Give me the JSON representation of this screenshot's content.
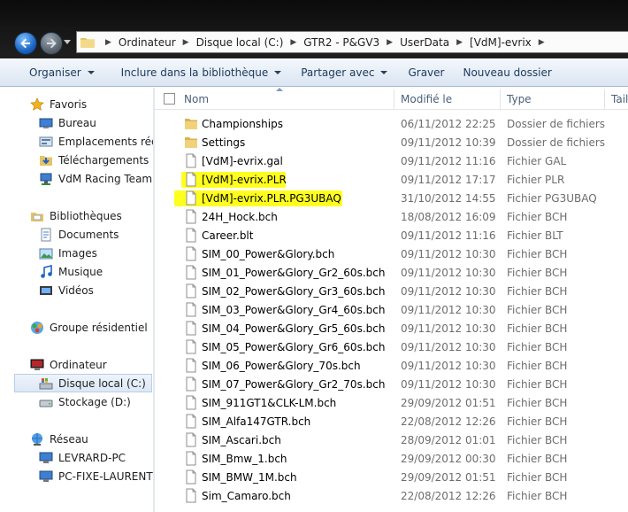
{
  "address": {
    "crumbs": [
      "Ordinateur",
      "Disque local (C:)",
      "GTR2 - P&GV3",
      "UserData",
      "[VdM]-evrix"
    ]
  },
  "toolbar": {
    "organize": "Organiser",
    "include_library": "Inclure dans la bibliothèque",
    "share_with": "Partager avec",
    "burn": "Graver",
    "new_folder": "Nouveau dossier"
  },
  "nav": {
    "favorites": "Favoris",
    "desktop": "Bureau",
    "recent": "Emplacements récents",
    "downloads": "Téléchargements",
    "vdm": "VdM Racing Team",
    "libraries": "Bibliothèques",
    "documents": "Documents",
    "images": "Images",
    "music": "Musique",
    "videos": "Vidéos",
    "homegroup": "Groupe résidentiel",
    "computer": "Ordinateur",
    "local_disk": "Disque local (C:)",
    "storage": "Stockage (D:)",
    "network": "Réseau",
    "pc1": "LEVRARD-PC",
    "pc2": "PC-FIXE-LAURENT"
  },
  "columns": {
    "name": "Nom",
    "modified": "Modifié le",
    "type": "Type",
    "size": "Taille"
  },
  "files": [
    {
      "name": "Championships",
      "date": "06/11/2012 22:25",
      "type": "Dossier de fichiers",
      "icon": "folder-icon"
    },
    {
      "name": "Settings",
      "date": "09/11/2012 10:39",
      "type": "Dossier de fichiers",
      "icon": "folder-icon"
    },
    {
      "name": "[VdM]-evrix.gal",
      "date": "09/11/2012 11:16",
      "type": "Fichier GAL",
      "icon": "file-icon"
    },
    {
      "name": "[VdM]-evrix.PLR",
      "date": "09/11/2012 17:17",
      "type": "Fichier PLR",
      "icon": "file-icon"
    },
    {
      "name": "[VdM]-evrix.PLR.PG3UBAQ",
      "date": "31/10/2012 14:55",
      "type": "Fichier PG3UBAQ",
      "icon": "file-icon"
    },
    {
      "name": "24H_Hock.bch",
      "date": "18/08/2012 16:09",
      "type": "Fichier BCH",
      "icon": "file-icon"
    },
    {
      "name": "Career.blt",
      "date": "09/11/2012 11:16",
      "type": "Fichier BLT",
      "icon": "file-icon"
    },
    {
      "name": "SIM_00_Power&Glory.bch",
      "date": "09/11/2012 10:30",
      "type": "Fichier BCH",
      "icon": "file-icon"
    },
    {
      "name": "SIM_01_Power&Glory_Gr2_60s.bch",
      "date": "09/11/2012 10:30",
      "type": "Fichier BCH",
      "icon": "file-icon"
    },
    {
      "name": "SIM_02_Power&Glory_Gr3_60s.bch",
      "date": "09/11/2012 10:30",
      "type": "Fichier BCH",
      "icon": "file-icon"
    },
    {
      "name": "SIM_03_Power&Glory_Gr4_60s.bch",
      "date": "09/11/2012 10:30",
      "type": "Fichier BCH",
      "icon": "file-icon"
    },
    {
      "name": "SIM_04_Power&Glory_Gr5_60s.bch",
      "date": "09/11/2012 10:30",
      "type": "Fichier BCH",
      "icon": "file-icon"
    },
    {
      "name": "SIM_05_Power&Glory_Gr6_60s.bch",
      "date": "09/11/2012 10:30",
      "type": "Fichier BCH",
      "icon": "file-icon"
    },
    {
      "name": "SIM_06_Power&Glory_70s.bch",
      "date": "09/11/2012 10:30",
      "type": "Fichier BCH",
      "icon": "file-icon"
    },
    {
      "name": "SIM_07_Power&Glory_Gr2_70s.bch",
      "date": "09/11/2012 10:30",
      "type": "Fichier BCH",
      "icon": "file-icon"
    },
    {
      "name": "SIM_911GT1&CLK-LM.bch",
      "date": "29/09/2012 01:51",
      "type": "Fichier BCH",
      "icon": "file-icon"
    },
    {
      "name": "SIM_Alfa147GTR.bch",
      "date": "22/08/2012 12:26",
      "type": "Fichier BCH",
      "icon": "file-icon"
    },
    {
      "name": "SIM_Ascari.bch",
      "date": "28/09/2012 01:01",
      "type": "Fichier BCH",
      "icon": "file-icon"
    },
    {
      "name": "SIM_Bmw_1.bch",
      "date": "29/09/2012 00:30",
      "type": "Fichier BCH",
      "icon": "file-icon"
    },
    {
      "name": "SIM_BMW_1M.bch",
      "date": "29/09/2012 01:51",
      "type": "Fichier BCH",
      "icon": "file-icon"
    },
    {
      "name": "Sim_Camaro.bch",
      "date": "22/08/2012 12:26",
      "type": "Fichier BCH",
      "icon": "file-icon"
    }
  ],
  "colors": {
    "highlight": "#ffff00",
    "toolbar_text": "#1e395b",
    "muted_text": "#6d6d6d"
  }
}
